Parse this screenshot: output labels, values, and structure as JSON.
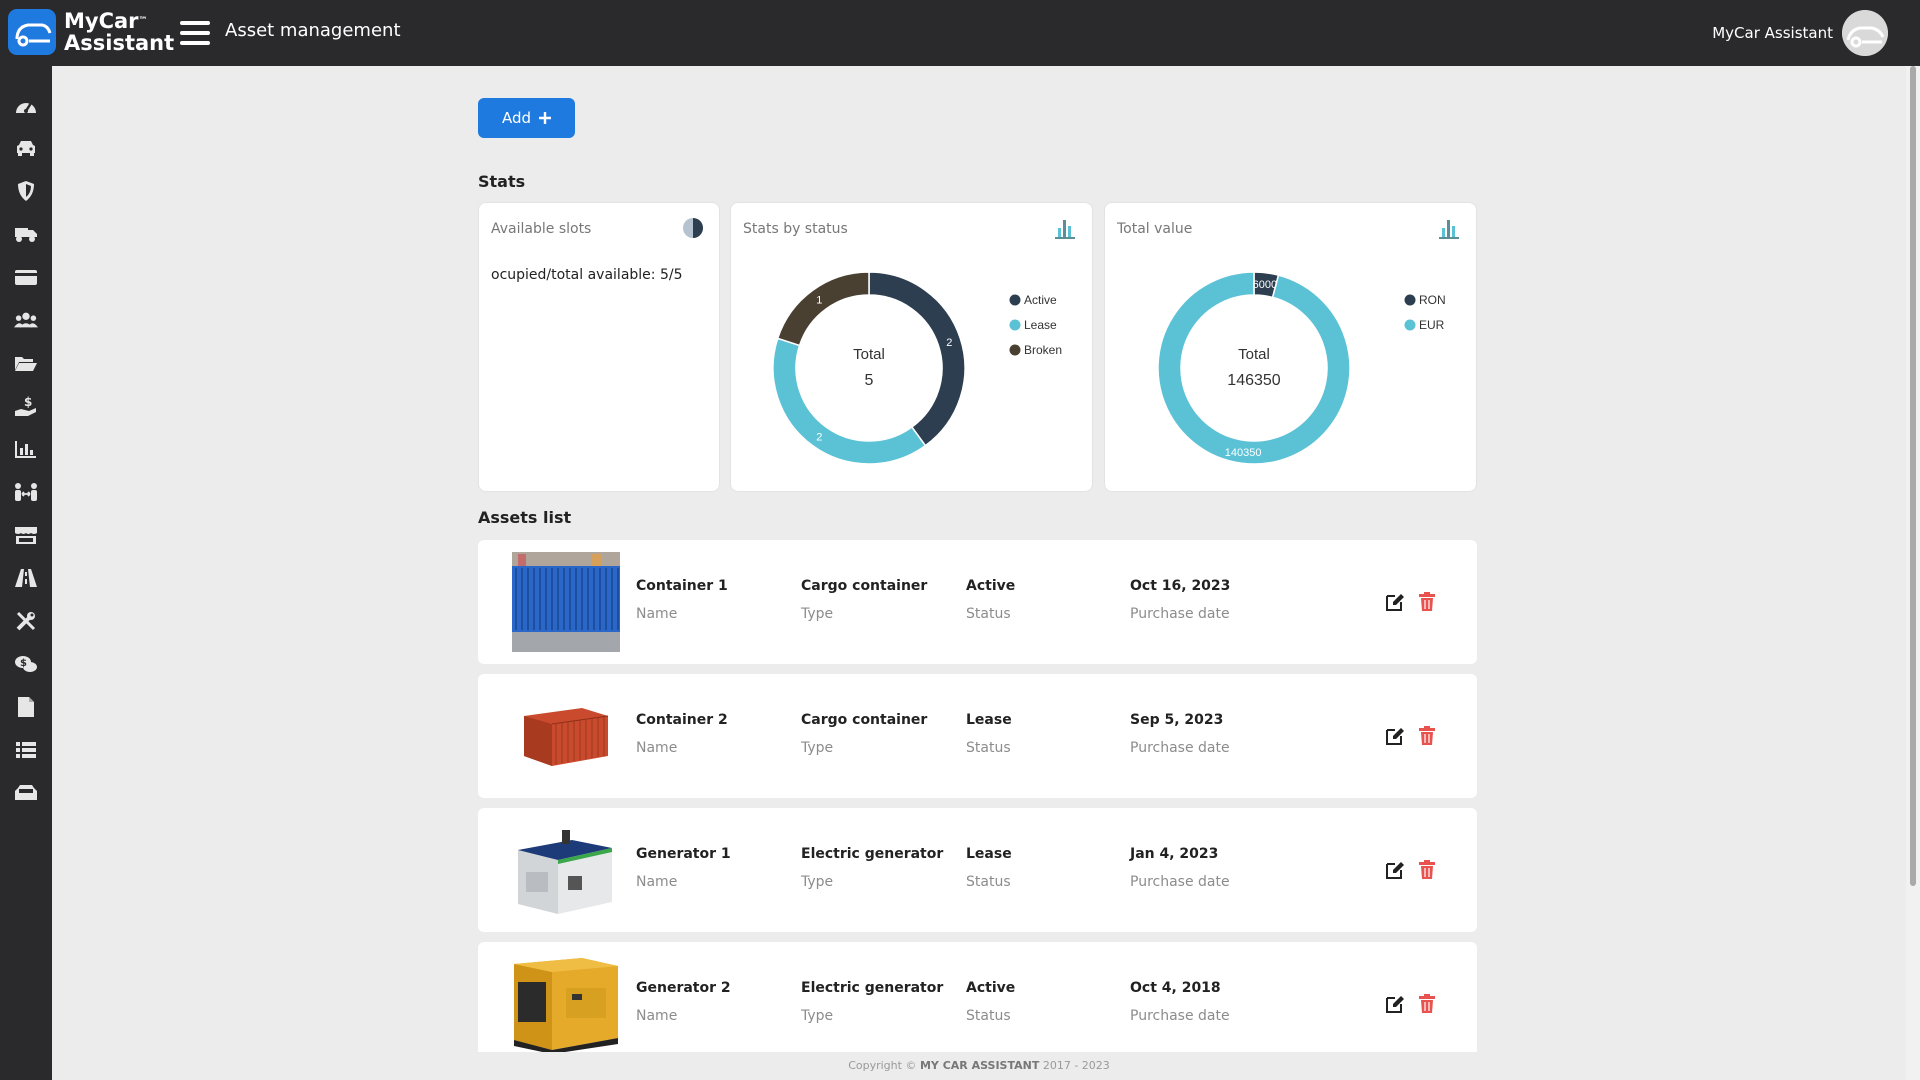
{
  "app": {
    "logo_line1": "MyCar",
    "logo_tm": "™",
    "logo_line2": "Assistant",
    "page_title": "Asset management",
    "user_name": "MyCar Assistant"
  },
  "sidebar": {
    "items": [
      {
        "icon": "speedometer-icon"
      },
      {
        "icon": "car-icon"
      },
      {
        "icon": "shield-icon"
      },
      {
        "icon": "truck-icon"
      },
      {
        "icon": "credit-card-icon"
      },
      {
        "icon": "users-icon"
      },
      {
        "icon": "folder-open-icon"
      },
      {
        "icon": "hand-dollar-icon"
      },
      {
        "icon": "bar-chart-icon"
      },
      {
        "icon": "people-arrows-icon"
      },
      {
        "icon": "store-icon"
      },
      {
        "icon": "road-icon"
      },
      {
        "icon": "tools-icon"
      },
      {
        "icon": "comments-dollar-icon"
      },
      {
        "icon": "file-icon"
      },
      {
        "icon": "list-icon"
      },
      {
        "icon": "inbox-car-icon"
      }
    ]
  },
  "toolbar": {
    "add_label": "Add",
    "add_icon": "plus-icon"
  },
  "stats": {
    "title": "Stats",
    "available_slots": {
      "title": "Available slots",
      "icon": "pie-half-icon",
      "text": "ocupied/total available: 5/5"
    },
    "by_status": {
      "title": "Stats by status",
      "icon": "bar-chart-icon",
      "center_label": "Total",
      "center_value": "5",
      "slice_labels": [
        "2",
        "2",
        "1"
      ]
    },
    "total_value": {
      "title": "Total value",
      "icon": "bar-chart-icon",
      "center_label": "Total",
      "center_value": "146350",
      "slice_labels": [
        "6000",
        "140350"
      ]
    }
  },
  "chart_data": [
    {
      "type": "pie",
      "title": "Stats by status",
      "categories": [
        "Active",
        "Lease",
        "Broken"
      ],
      "values": [
        2,
        2,
        1
      ],
      "colors": [
        "#2d3e50",
        "#5bc2d6",
        "#4a4031"
      ],
      "center_label": "Total",
      "center_value": 5,
      "legend": "right"
    },
    {
      "type": "pie",
      "title": "Total value",
      "categories": [
        "RON",
        "EUR"
      ],
      "values": [
        6000,
        140350
      ],
      "colors": [
        "#2d3e50",
        "#5bc2d6"
      ],
      "center_label": "Total",
      "center_value": 146350,
      "legend": "right"
    }
  ],
  "assets": {
    "title": "Assets list",
    "name_label": "Name",
    "type_label": "Type",
    "status_label": "Status",
    "date_label": "Purchase date",
    "rows": [
      {
        "name": "Container 1",
        "type": "Cargo container",
        "status": "Active",
        "date": "Oct 16, 2023",
        "image": "blue-container"
      },
      {
        "name": "Container 2",
        "type": "Cargo container",
        "status": "Lease",
        "date": "Sep 5, 2023",
        "image": "red-container"
      },
      {
        "name": "Generator 1",
        "type": "Electric generator",
        "status": "Lease",
        "date": "Jan 4, 2023",
        "image": "white-generator"
      },
      {
        "name": "Generator 2",
        "type": "Electric generator",
        "status": "Active",
        "date": "Oct 4, 2018",
        "image": "yellow-generator"
      }
    ]
  },
  "footer": {
    "prefix": "Copyright ©",
    "brand": "MY CAR ASSISTANT",
    "years": "2017 - 2023"
  },
  "colors": {
    "accent": "#1f7ae0",
    "topbar": "#2a2a2c",
    "delete": "#e8534f"
  }
}
